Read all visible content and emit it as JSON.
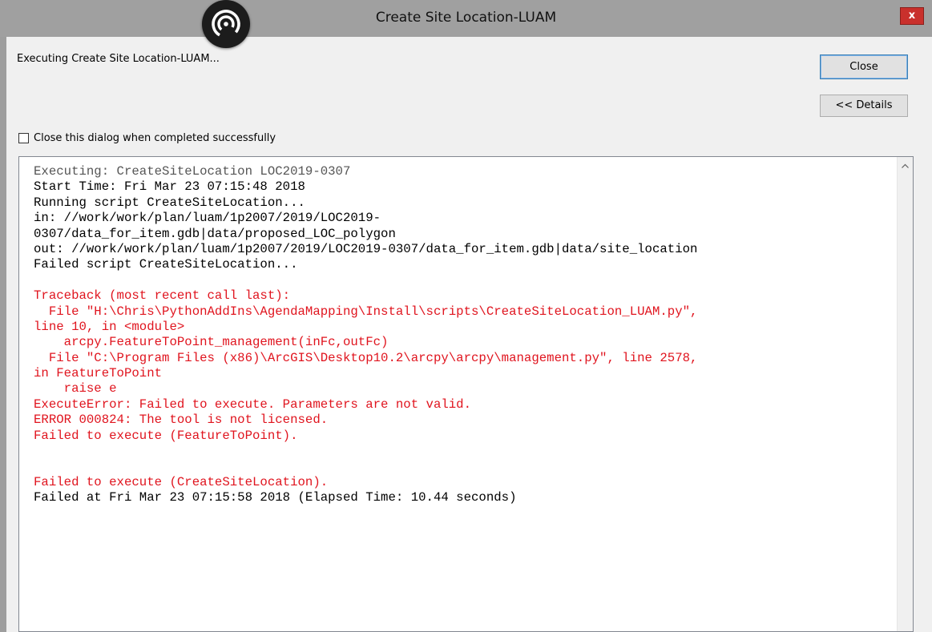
{
  "window": {
    "title": "Create Site Location-LUAM",
    "close_glyph": "x",
    "logo_icon": "app-swirl-icon"
  },
  "dialog": {
    "status_text": "Executing Create Site Location-LUAM...",
    "close_button_label": "Close",
    "details_button_label": "<< Details",
    "checkbox_label": "Close this dialog when completed successfully",
    "checkbox_checked": false
  },
  "colors": {
    "error_red": "#e0141e",
    "title_bar": "#a0a0a0",
    "close_button": "#c9302c"
  },
  "log": {
    "lines": [
      {
        "text": "Executing: CreateSiteLocation LOC2019-0307",
        "style": "gray"
      },
      {
        "text": "Start Time: Fri Mar 23 07:15:48 2018",
        "style": "black"
      },
      {
        "text": "Running script CreateSiteLocation...",
        "style": "black"
      },
      {
        "text": "in: //work/work/plan/luam/1p2007/2019/LOC2019-",
        "style": "black"
      },
      {
        "text": "0307/data_for_item.gdb|data/proposed_LOC_polygon",
        "style": "black"
      },
      {
        "text": "out: //work/work/plan/luam/1p2007/2019/LOC2019-0307/data_for_item.gdb|data/site_location",
        "style": "black"
      },
      {
        "text": "Failed script CreateSiteLocation...",
        "style": "black"
      },
      {
        "text": "",
        "style": "black"
      },
      {
        "text": "Traceback (most recent call last):",
        "style": "red"
      },
      {
        "text": "  File \"H:\\Chris\\PythonAddIns\\AgendaMapping\\Install\\scripts\\CreateSiteLocation_LUAM.py\",",
        "style": "red"
      },
      {
        "text": "line 10, in <module>",
        "style": "red"
      },
      {
        "text": "    arcpy.FeatureToPoint_management(inFc,outFc)",
        "style": "red"
      },
      {
        "text": "  File \"C:\\Program Files (x86)\\ArcGIS\\Desktop10.2\\arcpy\\arcpy\\management.py\", line 2578,",
        "style": "red"
      },
      {
        "text": "in FeatureToPoint",
        "style": "red"
      },
      {
        "text": "    raise e",
        "style": "red"
      },
      {
        "text": "ExecuteError: Failed to execute. Parameters are not valid.",
        "style": "red"
      },
      {
        "text": "ERROR 000824: The tool is not licensed.",
        "style": "red"
      },
      {
        "text": "Failed to execute (FeatureToPoint).",
        "style": "red"
      },
      {
        "text": "",
        "style": "red"
      },
      {
        "text": "",
        "style": "red"
      },
      {
        "text": "Failed to execute (CreateSiteLocation).",
        "style": "red"
      },
      {
        "text": "Failed at Fri Mar 23 07:15:58 2018 (Elapsed Time: 10.44 seconds)",
        "style": "black"
      }
    ]
  }
}
